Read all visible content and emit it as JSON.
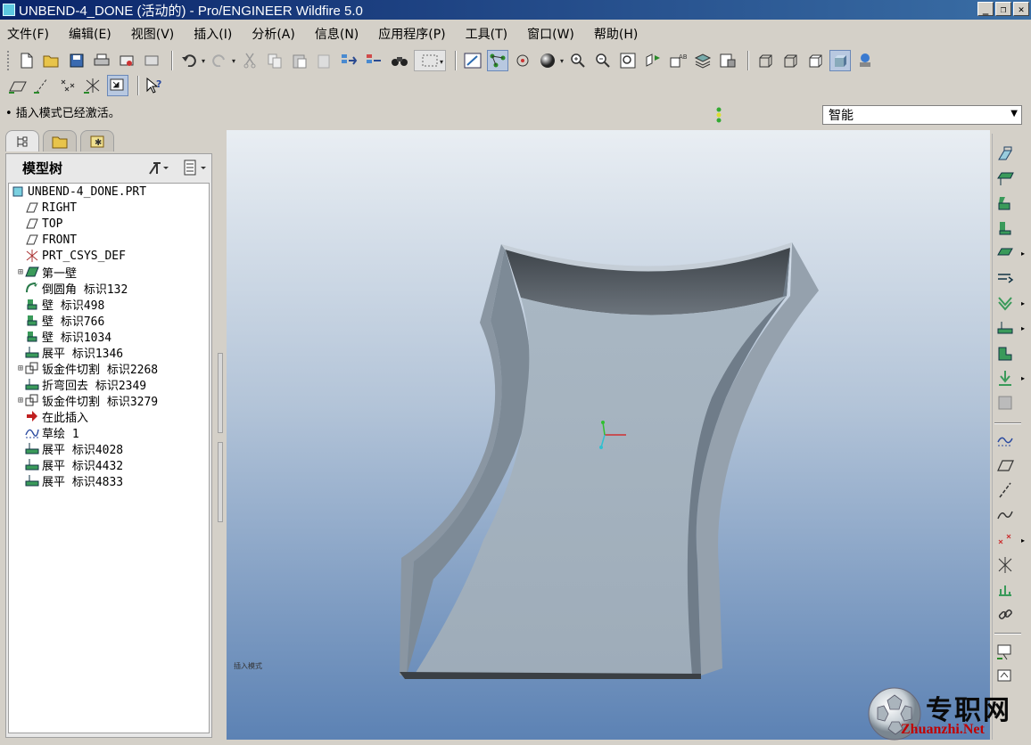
{
  "window": {
    "title": "UNBEND-4_DONE (活动的) - Pro/ENGINEER Wildfire 5.0",
    "buttons": [
      "_",
      "❐",
      "✕"
    ]
  },
  "menu": [
    "文件(F)",
    "编辑(E)",
    "视图(V)",
    "插入(I)",
    "分析(A)",
    "信息(N)",
    "应用程序(P)",
    "工具(T)",
    "窗口(W)",
    "帮助(H)"
  ],
  "status": {
    "message": "• 插入模式已经激活。",
    "filter_value": "智能"
  },
  "model_tree": {
    "header": "模型树",
    "root": "UNBEND-4_DONE.PRT",
    "items": [
      {
        "label": "RIGHT",
        "icon": "datum-plane-icon",
        "expand": false
      },
      {
        "label": "TOP",
        "icon": "datum-plane-icon",
        "expand": false
      },
      {
        "label": "FRONT",
        "icon": "datum-plane-icon",
        "expand": false
      },
      {
        "label": "PRT_CSYS_DEF",
        "icon": "csys-icon",
        "expand": false
      },
      {
        "label": "第一壁",
        "icon": "first-wall-icon",
        "expand": true
      },
      {
        "label": "倒圆角 标识132",
        "icon": "round-icon",
        "expand": false
      },
      {
        "label": "壁 标识498",
        "icon": "wall-icon",
        "expand": false
      },
      {
        "label": "壁 标识766",
        "icon": "wall-icon",
        "expand": false
      },
      {
        "label": "壁 标识1034",
        "icon": "wall-icon",
        "expand": false
      },
      {
        "label": "展平 标识1346",
        "icon": "unbend-icon",
        "expand": false
      },
      {
        "label": "钣金件切割 标识2268",
        "icon": "sheetmetal-cut-icon",
        "expand": true
      },
      {
        "label": "折弯回去 标识2349",
        "icon": "bend-back-icon",
        "expand": false
      },
      {
        "label": "钣金件切割 标识3279",
        "icon": "sheetmetal-cut-icon",
        "expand": true
      },
      {
        "label": "在此插入",
        "icon": "insert-here-arrow-icon",
        "expand": false
      },
      {
        "label": "草绘 1",
        "icon": "sketch-icon",
        "expand": false
      },
      {
        "label": "展平 标识4028",
        "icon": "unbend-icon",
        "expand": false
      },
      {
        "label": "展平 标识4432",
        "icon": "unbend-icon",
        "expand": false
      },
      {
        "label": "展平 标识4833",
        "icon": "unbend-icon",
        "expand": false
      }
    ]
  },
  "viewport": {
    "note": "插入模式"
  },
  "watermark": {
    "cn": "专职网",
    "en": "Zhuanzhi.Net"
  }
}
